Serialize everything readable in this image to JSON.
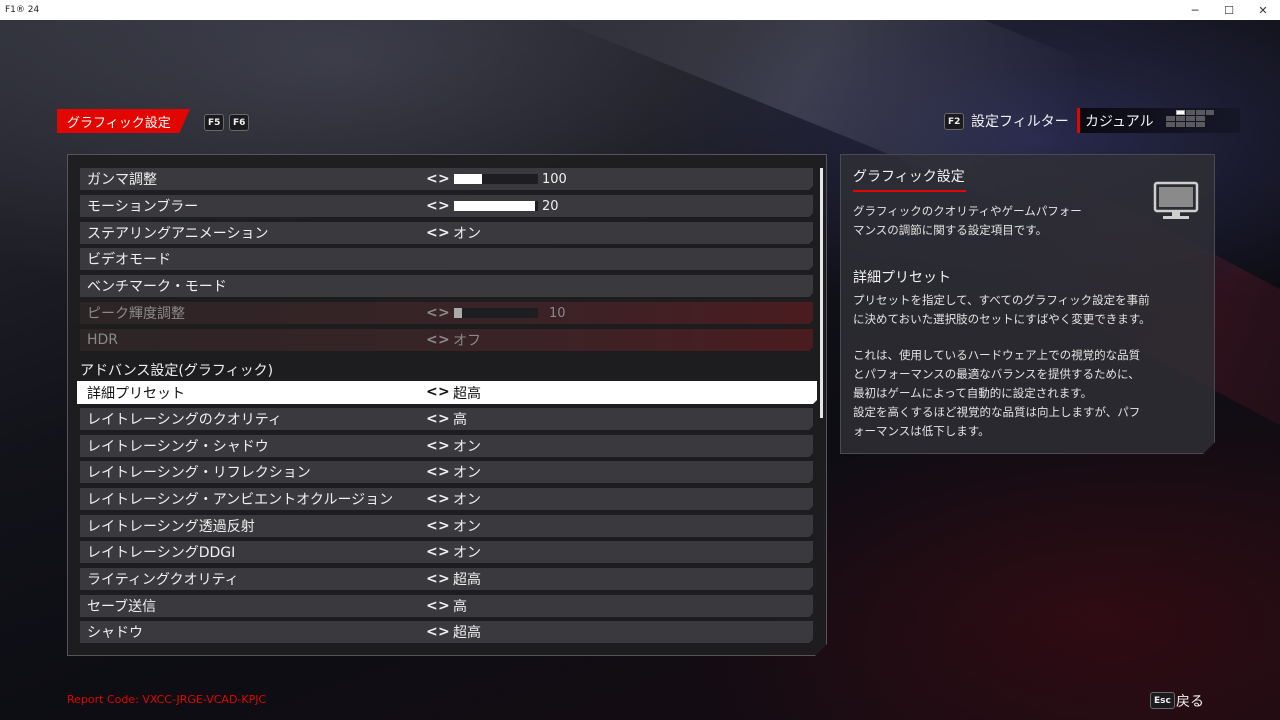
{
  "window": {
    "title": "F1® 24",
    "minimize": "─",
    "maximize": "☐",
    "close": "✕"
  },
  "header": {
    "active_tab": "グラフィック設定",
    "key_prev": "F5",
    "key_next": "F6",
    "filter_key": "F2",
    "filter_label": "設定フィルター",
    "filter_value": "カジュアル"
  },
  "settings": {
    "arrow_left": "<",
    "arrow_right": ">",
    "rows": [
      {
        "label": "ガンマ調整",
        "value": "100",
        "slider": 0.33
      },
      {
        "label": "モーションブラー",
        "value": "20",
        "slider": 1.0
      },
      {
        "label": "ステアリングアニメーション",
        "value": "オン"
      },
      {
        "label": "ビデオモード",
        "value": ""
      },
      {
        "label": "ベンチマーク・モード",
        "value": ""
      },
      {
        "label": "ピーク輝度調整",
        "value": "10",
        "slider": 0.1
      },
      {
        "label": "HDR",
        "value": "オフ"
      }
    ],
    "advanced_header": "アドバンス設定(グラフィック)",
    "advanced_rows": [
      {
        "label": "詳細プリセット",
        "value": "超高"
      },
      {
        "label": "レイトレーシングのクオリティ",
        "value": "高"
      },
      {
        "label": "レイトレーシング・シャドウ",
        "value": "オン"
      },
      {
        "label": "レイトレーシング・リフレクション",
        "value": "オン"
      },
      {
        "label": "レイトレーシング・アンビエントオクルージョン",
        "value": "オン"
      },
      {
        "label": "レイトレーシング透過反射",
        "value": "オン"
      },
      {
        "label": "レイトレーシングDDGI",
        "value": "オン"
      },
      {
        "label": "ライティングクオリティ",
        "value": "超高"
      },
      {
        "label": "セーブ送信",
        "value": "高"
      },
      {
        "label": "シャドウ",
        "value": "超高"
      }
    ]
  },
  "info": {
    "title": "グラフィック設定",
    "desc_line1": "グラフィックのクオリティやゲームパフォー",
    "desc_line2": "マンスの調節に関する設定項目です。",
    "sub_title": "詳細プリセット",
    "sub_line1": "プリセットを指定して、すべてのグラフィック設定を事前",
    "sub_line2": "に決めておいた選択肢のセットにすばやく変更できます。",
    "sub_line3": "これは、使用しているハードウェア上での視覚的な品質",
    "sub_line4": "とパフォーマンスの最適なバランスを提供するために、",
    "sub_line5": "最初はゲームによって自動的に設定されます。",
    "sub_line6": "設定を高くするほど視覚的な品質は向上しますが、パフ",
    "sub_line7": "ォーマンスは低下します。",
    "icon": "monitor-icon"
  },
  "footer": {
    "report_code": "Report Code: VXCC-JRGE-VCAD-KPJC",
    "back_key": "Esc",
    "back_label": "戻る"
  },
  "colors": {
    "accent": "#e10600",
    "row_bg": "#3a3a3e",
    "selected_bg": "#ffffff"
  }
}
